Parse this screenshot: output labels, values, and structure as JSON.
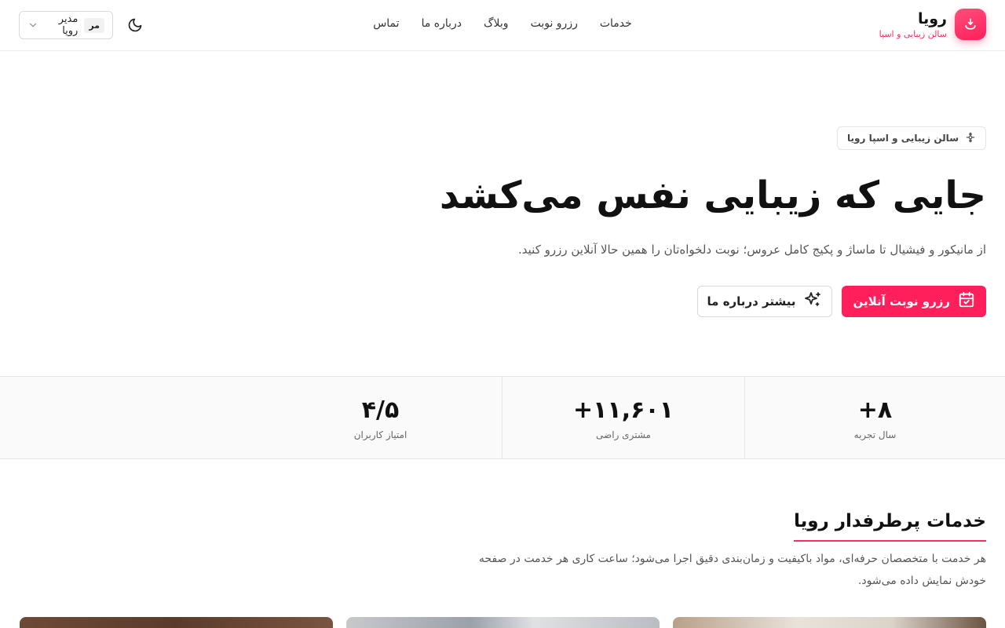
{
  "brand": {
    "name": "رویا",
    "tagline": "سالن زیبایی و اسپا"
  },
  "nav": {
    "items": [
      "خدمات",
      "رزرو نوبت",
      "وبلاگ",
      "درباره ما",
      "تماس"
    ]
  },
  "user_menu": {
    "avatar_initials": "مر",
    "name": "مدیر رویا"
  },
  "hero": {
    "badge": "سالن زیبایی و اسپا رویا",
    "title": "جایی که زیبایی نفس می‌کشد",
    "subtitle": "از مانیکور و فیشیال تا ماساژ و پکیج کامل عروس؛ نوبت دلخواه‌تان را همین حالا آنلاین رزرو کنید.",
    "primary_cta": "رزرو نوبت آنلاین",
    "secondary_cta": "بیشتر درباره ما"
  },
  "stats": [
    {
      "value": "۸+",
      "label": "سال تجربه"
    },
    {
      "value": "۱۱,۶۰۱+",
      "label": "مشتری راضی"
    },
    {
      "value": "۴/۵",
      "label": "امتیاز کاربران"
    }
  ],
  "services": {
    "title": "خدمات پرطرفدار رویا",
    "description": "هر خدمت با متخصصان حرفه‌ای، مواد باکیفیت و زمان‌بندی دقیق اجرا می‌شود؛ ساعت کاری هر خدمت در صفحه خودش نمایش داده می‌شود."
  },
  "colors": {
    "accent": "#ff1f5a",
    "border": "#e6e6e6",
    "stats_bg": "#fafafa"
  },
  "icons": {
    "brand": "lotus-icon",
    "badge": "flower-icon",
    "primary_cta": "calendar-check-icon",
    "secondary_cta": "sparkles-icon",
    "theme": "moon-icon",
    "user_menu": "chevron-down-icon"
  }
}
